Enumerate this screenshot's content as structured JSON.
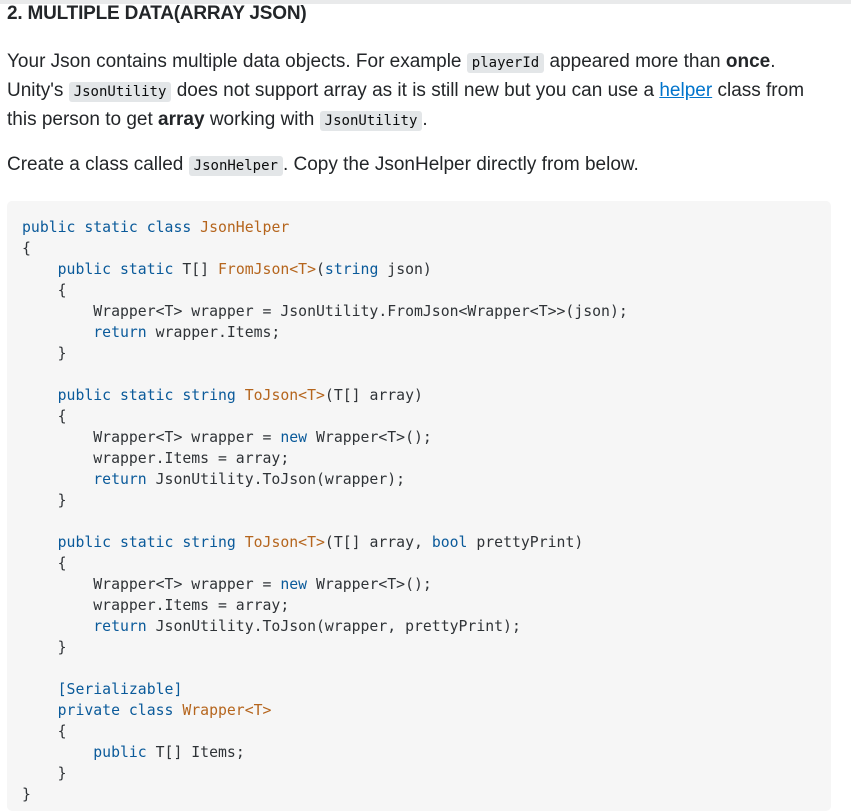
{
  "heading": "2. MULTIPLE DATA(ARRAY JSON)",
  "para1": {
    "t1": "Your Json contains multiple data objects. For example ",
    "code1": "playerId",
    "t2": " appeared more than ",
    "bold1": "once",
    "t3": ".",
    "t4": "Unity's ",
    "code2": "JsonUtility",
    "t5": " does not support array as it is still new but you can use a ",
    "link": "helper",
    "t6": " class from",
    "t7": "this person to get ",
    "bold2": "array",
    "t8": " working with ",
    "code3": "JsonUtility",
    "t9": "."
  },
  "para2": {
    "t1": "Create a class called ",
    "code1": "JsonHelper",
    "t2": ". Copy the JsonHelper directly from below."
  },
  "code": {
    "l1_kw": "public static class ",
    "l1_ty": "JsonHelper",
    "l2": "{",
    "l3_kw": "    public static ",
    "l3_tx": "T[] ",
    "l3_ty": "FromJson<T>",
    "l3_tx2": "(",
    "l3_kw2": "string",
    "l3_tx3": " json)",
    "l4": "    {",
    "l5": "        Wrapper<T> wrapper = JsonUtility.FromJson<Wrapper<T>>(json);",
    "l6_kw": "        return",
    "l6_tx": " wrapper.Items;",
    "l7": "    }",
    "l8": "",
    "l9_kw": "    public static string ",
    "l9_ty": "ToJson<T>",
    "l9_tx": "(T[] array)",
    "l10": "    {",
    "l11_tx": "        Wrapper<T> wrapper = ",
    "l11_kw": "new",
    "l11_tx2": " Wrapper<T>();",
    "l12": "        wrapper.Items = array;",
    "l13_kw": "        return",
    "l13_tx": " JsonUtility.ToJson(wrapper);",
    "l14": "    }",
    "l15": "",
    "l16_kw": "    public static string ",
    "l16_ty": "ToJson<T>",
    "l16_tx": "(T[] array, ",
    "l16_kw2": "bool",
    "l16_tx2": " prettyPrint)",
    "l17": "    {",
    "l18_tx": "        Wrapper<T> wrapper = ",
    "l18_kw": "new",
    "l18_tx2": " Wrapper<T>();",
    "l19": "        wrapper.Items = array;",
    "l20_kw": "        return",
    "l20_tx": " JsonUtility.ToJson(wrapper, prettyPrint);",
    "l21": "    }",
    "l22": "",
    "l23": "    [Serializable]",
    "l24_kw": "    private class ",
    "l24_ty": "Wrapper<T>",
    "l25": "    {",
    "l26_kw": "        public ",
    "l26_tx": "T[] Items;",
    "l27": "    }",
    "l28": "}"
  }
}
